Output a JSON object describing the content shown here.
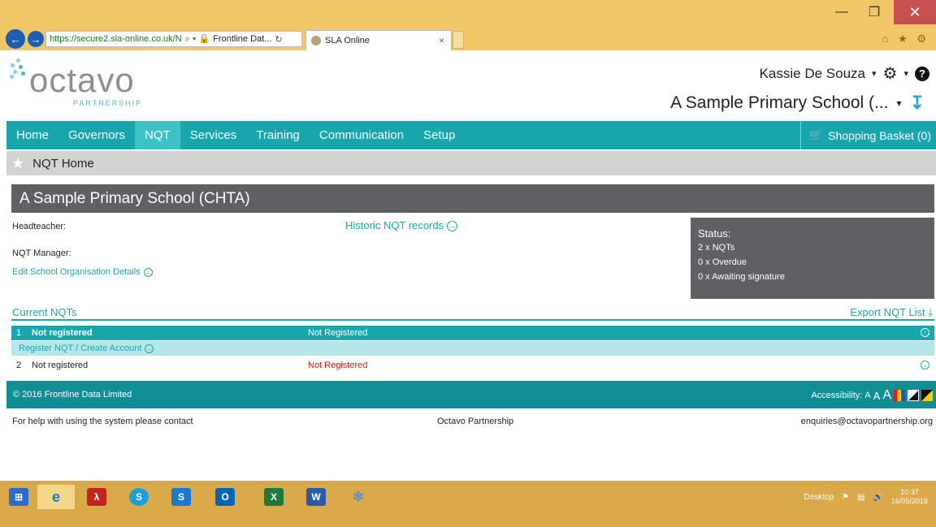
{
  "window": {
    "minimize": "—",
    "maximize": "❐",
    "close": "✕"
  },
  "browser": {
    "url": "https://secure2.sla-online.co.uk/N",
    "address_icons": "⌕ ▾ 🔒",
    "site_identity": "Frontline Dat...",
    "refresh": "↻",
    "tab_title": "SLA Online",
    "tab_close": "×",
    "toolbar_icons": "⌂ ★ ⚙"
  },
  "header": {
    "logo_text": "octavo",
    "logo_sub": "PARTNERSHIP",
    "user_name": "Kassie De Souza",
    "school_selector": "A Sample Primary School (...",
    "chevron": "▾"
  },
  "nav": {
    "items": [
      "Home",
      "Governors",
      "NQT",
      "Services",
      "Training",
      "Communication",
      "Setup"
    ],
    "active": "NQT",
    "basket": "Shopping Basket (0)"
  },
  "breadcrumb": {
    "title": "NQT Home"
  },
  "school": {
    "name": "A Sample Primary School (CHTA)",
    "headteacher_label": "Headteacher:",
    "nqt_manager_label": "NQT Manager:",
    "edit_link": "Edit School Organisation Details",
    "historic_link": "Historic NQT records"
  },
  "status": {
    "title": "Status:",
    "lines": [
      "2 x NQTs",
      "0 x Overdue",
      "0 x Awaiting signature"
    ]
  },
  "current_nqts": {
    "title": "Current NQTs",
    "export": "Export NQT List",
    "rows": [
      {
        "num": "1",
        "name": "Not registered",
        "status": "Not Registered",
        "action": "Register NQT / Create Account"
      },
      {
        "num": "2",
        "name": "Not registered",
        "status": "Not Registered"
      }
    ]
  },
  "footer": {
    "copyright": "© 2016 Frontline Data Limited",
    "accessibility": "Accessibility:",
    "a_small": "A",
    "a_medium": "A",
    "a_large": "A"
  },
  "contact": {
    "help_text": "For help with using the system please contact",
    "org": "Octavo Partnership",
    "email": "enquiries@octavopartnership.org"
  },
  "taskbar": {
    "desktop": "Desktop",
    "time": "10:37",
    "date": "16/05/2016"
  }
}
